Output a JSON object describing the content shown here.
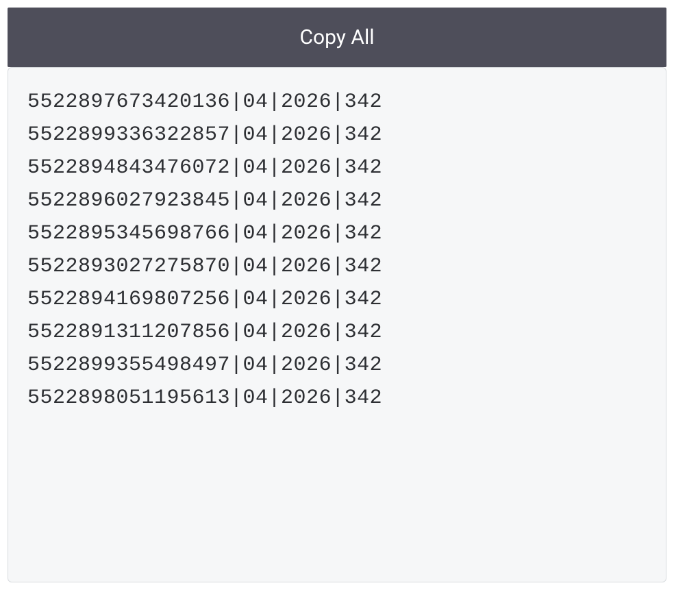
{
  "toolbar": {
    "copy_all_label": "Copy All"
  },
  "output": {
    "lines": [
      "5522897673420136|04|2026|342",
      "5522899336322857|04|2026|342",
      "5522894843476072|04|2026|342",
      "5522896027923845|04|2026|342",
      "5522895345698766|04|2026|342",
      "5522893027275870|04|2026|342",
      "5522894169807256|04|2026|342",
      "5522891311207856|04|2026|342",
      "5522899355498497|04|2026|342",
      "5522898051195613|04|2026|342"
    ]
  }
}
